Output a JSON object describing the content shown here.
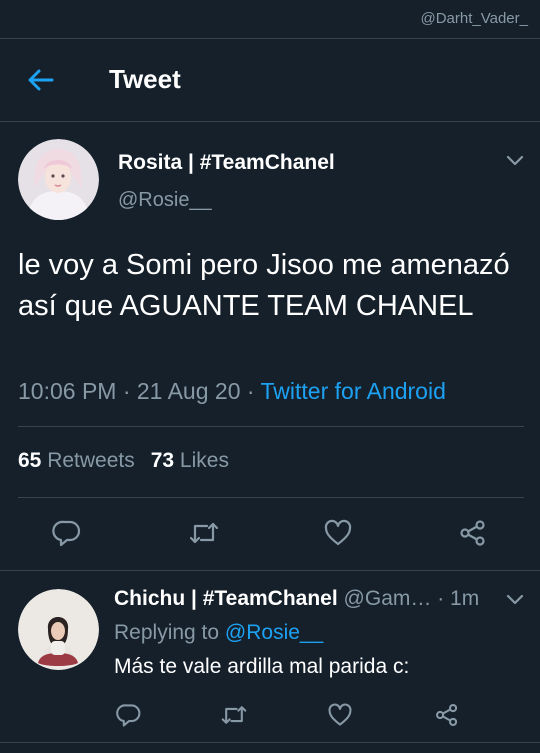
{
  "watermark": "@Darht_Vader_",
  "header": {
    "title": "Tweet"
  },
  "tweet": {
    "display_name": "Rosita | #TeamChanel",
    "handle": "@Rosie__",
    "text": "le voy a Somi pero Jisoo me amenazó así que AGUANTE TEAM CHANEL",
    "time": "10:06 PM · 21 Aug 20 · ",
    "source": "Twitter for Android",
    "retweets_count": "65",
    "retweets_label": " Retweets",
    "likes_count": "73",
    "likes_label": " Likes"
  },
  "reply": {
    "display_name": "Chichu | #TeamChanel",
    "handle": " @Gam…",
    "time": " · 1m",
    "replying_label": "Replying to ",
    "replying_to": "@Rosie__",
    "text": "Más te vale ardilla mal parida c:"
  },
  "colors": {
    "background": "#15202b",
    "accent": "#1da1f2",
    "secondary_text": "#8899a6",
    "divider": "#38444d"
  },
  "icons": {
    "back": "arrow-left-icon",
    "menu": "chevron-down-icon",
    "reply": "reply-icon",
    "retweet": "retweet-icon",
    "like": "heart-icon",
    "share": "share-icon"
  }
}
